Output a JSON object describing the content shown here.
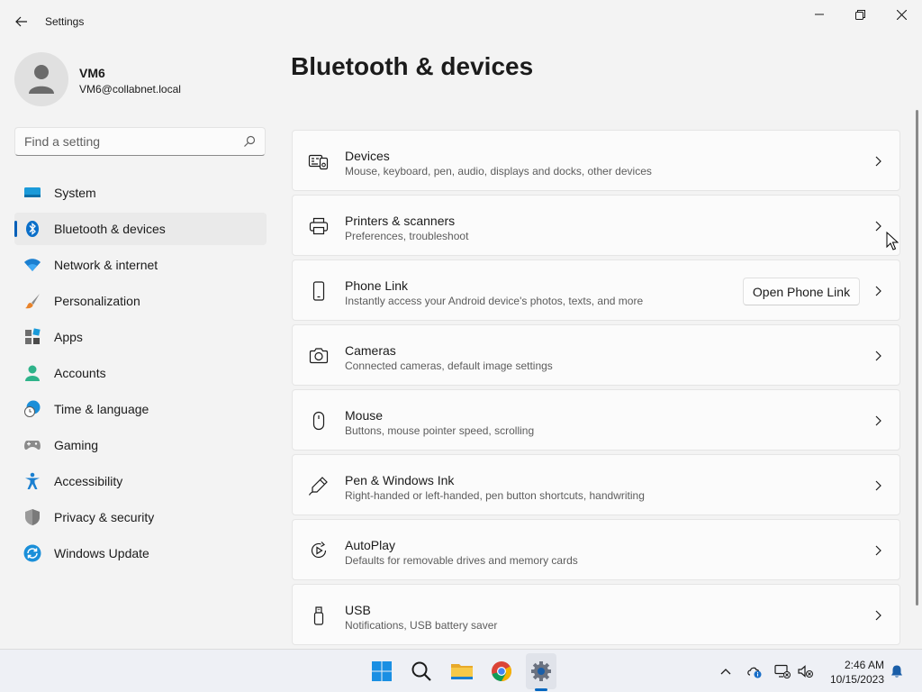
{
  "window": {
    "title": "Settings"
  },
  "profile": {
    "name": "VM6",
    "email": "VM6@collabnet.local"
  },
  "search": {
    "placeholder": "Find a setting"
  },
  "nav": {
    "items": [
      {
        "label": "System",
        "icon": "system-icon"
      },
      {
        "label": "Bluetooth & devices",
        "icon": "bluetooth-icon",
        "selected": true
      },
      {
        "label": "Network & internet",
        "icon": "wifi-icon"
      },
      {
        "label": "Personalization",
        "icon": "brush-icon"
      },
      {
        "label": "Apps",
        "icon": "apps-icon"
      },
      {
        "label": "Accounts",
        "icon": "accounts-icon"
      },
      {
        "label": "Time & language",
        "icon": "globe-clock-icon"
      },
      {
        "label": "Gaming",
        "icon": "gamepad-icon"
      },
      {
        "label": "Accessibility",
        "icon": "accessibility-icon"
      },
      {
        "label": "Privacy & security",
        "icon": "shield-icon"
      },
      {
        "label": "Windows Update",
        "icon": "update-icon"
      }
    ]
  },
  "page": {
    "title": "Bluetooth & devices"
  },
  "cards": [
    {
      "title": "Devices",
      "desc": "Mouse, keyboard, pen, audio, displays and docks, other devices",
      "icon": "devices-icon"
    },
    {
      "title": "Printers & scanners",
      "desc": "Preferences, troubleshoot",
      "icon": "printer-icon"
    },
    {
      "title": "Phone Link",
      "desc": "Instantly access your Android device's photos, texts, and more",
      "icon": "phone-icon",
      "button": "Open Phone Link"
    },
    {
      "title": "Cameras",
      "desc": "Connected cameras, default image settings",
      "icon": "camera-icon"
    },
    {
      "title": "Mouse",
      "desc": "Buttons, mouse pointer speed, scrolling",
      "icon": "mouse-icon"
    },
    {
      "title": "Pen & Windows Ink",
      "desc": "Right-handed or left-handed, pen button shortcuts, handwriting",
      "icon": "pen-icon"
    },
    {
      "title": "AutoPlay",
      "desc": "Defaults for removable drives and memory cards",
      "icon": "autoplay-icon"
    },
    {
      "title": "USB",
      "desc": "Notifications, USB battery saver",
      "icon": "usb-icon"
    }
  ],
  "taskbar": {
    "time": "2:46 AM",
    "date": "10/15/2023",
    "apps": [
      "start-icon",
      "search-icon",
      "file-explorer-icon",
      "chrome-icon",
      "settings-icon"
    ]
  },
  "colors": {
    "accent": "#005fb8",
    "background": "#f3f3f3",
    "card": "#fbfbfb"
  }
}
